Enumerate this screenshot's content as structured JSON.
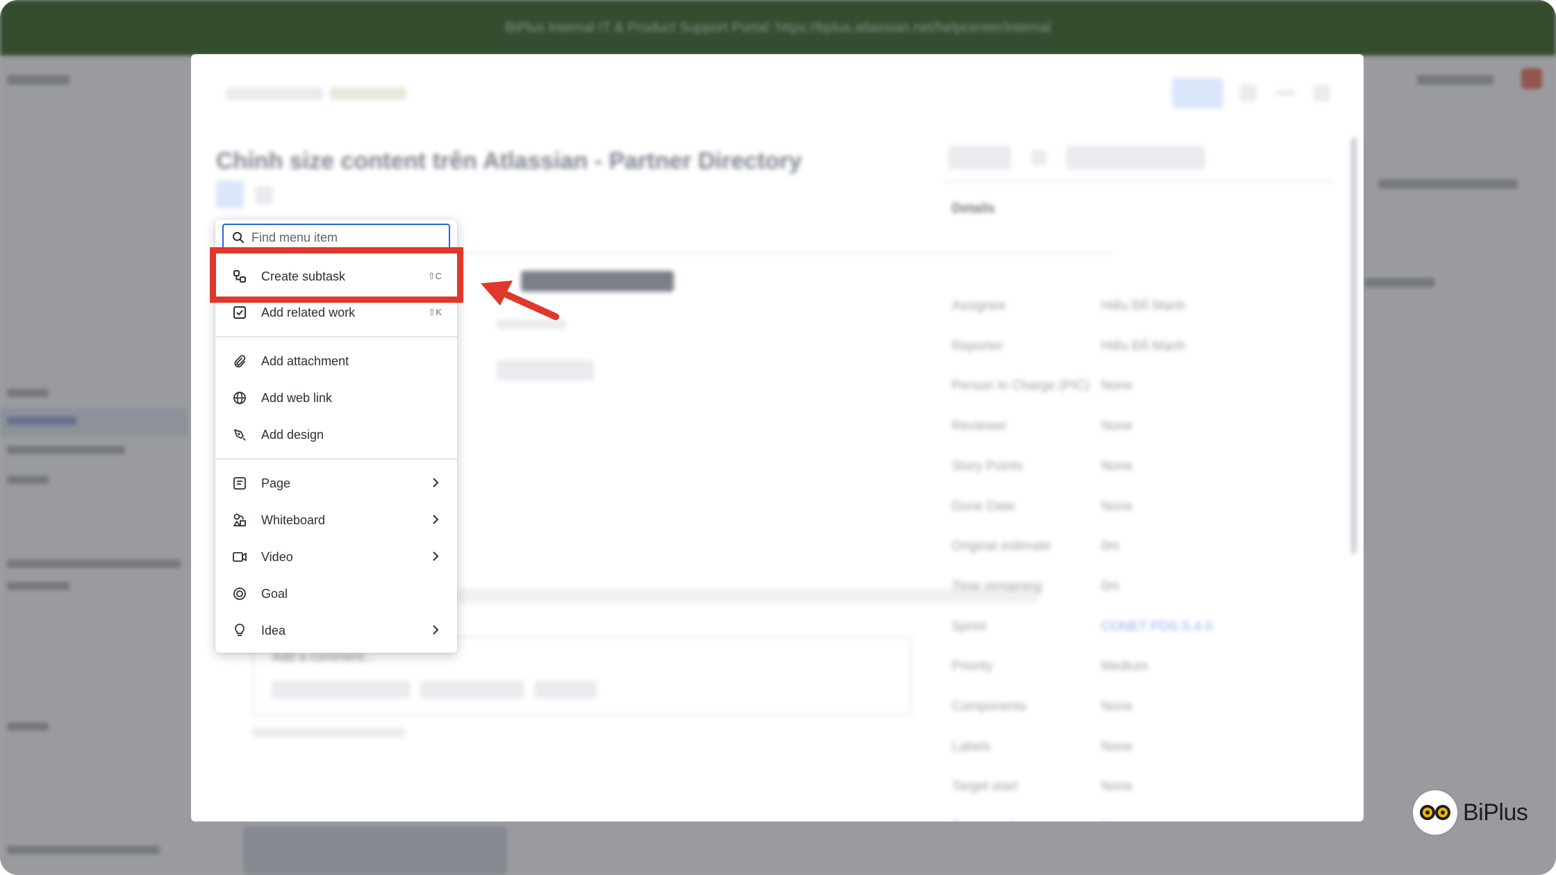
{
  "menu": {
    "search_placeholder": "Find menu item",
    "items": [
      {
        "label": "Create subtask",
        "shortcut": "⇧C"
      },
      {
        "label": "Add related work",
        "shortcut": "⇧K"
      },
      {
        "label": "Add attachment"
      },
      {
        "label": "Add web link"
      },
      {
        "label": "Add design"
      },
      {
        "label": "Page"
      },
      {
        "label": "Whiteboard"
      },
      {
        "label": "Video"
      },
      {
        "label": "Goal"
      },
      {
        "label": "Idea"
      }
    ]
  },
  "background": {
    "banner": "BiPlus Internal IT & Product Support Portal: https://bplus.atlassian.net/helpcenter/internal",
    "issue_title": "Chỉnh size content trên Atlassian - Partner Directory",
    "comment_placeholder": "Add a comment...",
    "details_header": "Details",
    "fields": [
      {
        "label": "Assignee",
        "value": "Hiếu Đỗ Mạnh"
      },
      {
        "label": "Reporter",
        "value": "Hiếu Đỗ Mạnh"
      },
      {
        "label": "Person In Charge (PIC)",
        "value": "None"
      },
      {
        "label": "Reviewer",
        "value": "None"
      },
      {
        "label": "Story Points",
        "value": "None"
      },
      {
        "label": "Done Date",
        "value": "None"
      },
      {
        "label": "Original estimate",
        "value": "0m"
      },
      {
        "label": "Time remaining",
        "value": "0m"
      },
      {
        "label": "Sprint",
        "value": "CONET PDS S.4.0"
      },
      {
        "label": "Priority",
        "value": "Medium"
      },
      {
        "label": "Components",
        "value": "None"
      },
      {
        "label": "Labels",
        "value": "None"
      },
      {
        "label": "Target start",
        "value": "None"
      },
      {
        "label": "Target end",
        "value": "None"
      }
    ]
  },
  "logo": {
    "text": "BiPlus"
  },
  "colors": {
    "highlight": "#e0382b",
    "banner": "#2d5a1e",
    "focus": "#2563eb"
  }
}
